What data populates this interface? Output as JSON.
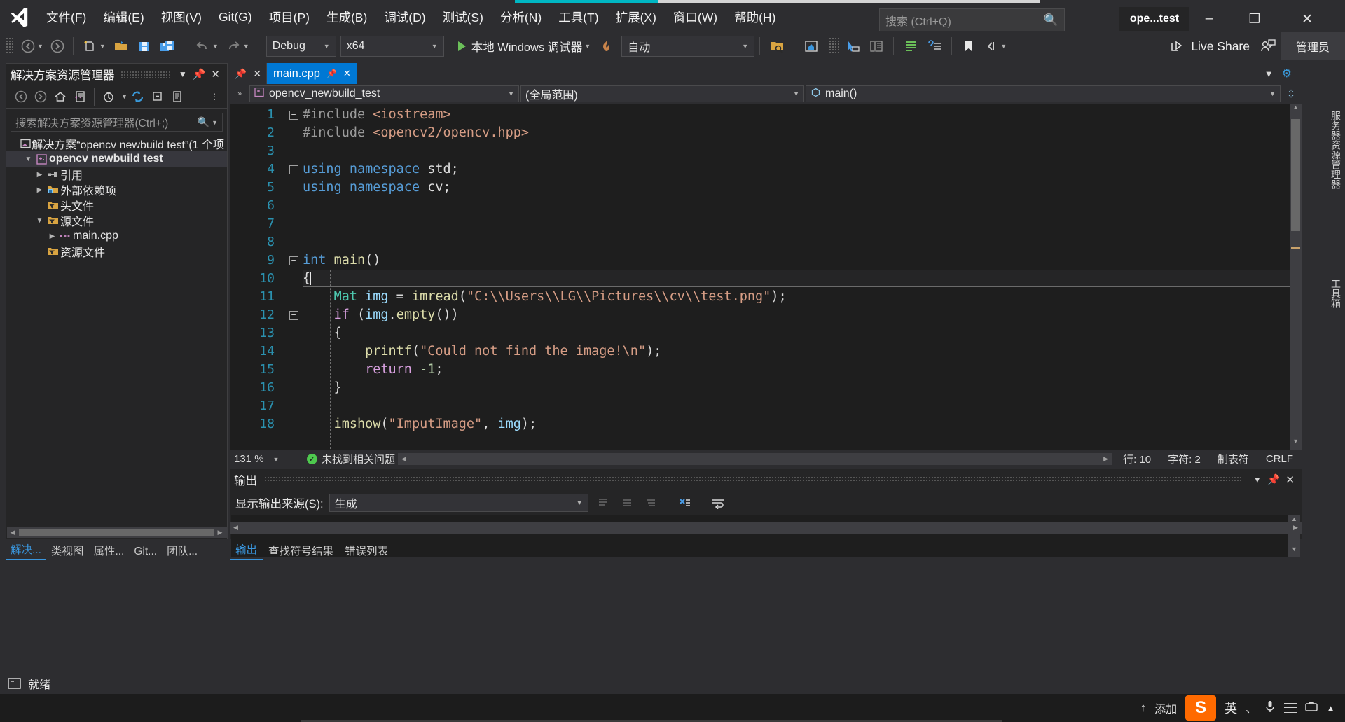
{
  "window": {
    "project_badge": "ope...test",
    "minimize": "–",
    "maximize": "❐",
    "close": "✕"
  },
  "menu": {
    "items": [
      {
        "label": "文件(F)",
        "name": "menu-file"
      },
      {
        "label": "编辑(E)",
        "name": "menu-edit"
      },
      {
        "label": "视图(V)",
        "name": "menu-view"
      },
      {
        "label": "Git(G)",
        "name": "menu-git"
      },
      {
        "label": "项目(P)",
        "name": "menu-project"
      },
      {
        "label": "生成(B)",
        "name": "menu-build"
      },
      {
        "label": "调试(D)",
        "name": "menu-debug"
      },
      {
        "label": "测试(S)",
        "name": "menu-test"
      },
      {
        "label": "分析(N)",
        "name": "menu-analyze"
      },
      {
        "label": "工具(T)",
        "name": "menu-tools"
      },
      {
        "label": "扩展(X)",
        "name": "menu-extensions"
      },
      {
        "label": "窗口(W)",
        "name": "menu-window"
      },
      {
        "label": "帮助(H)",
        "name": "menu-help"
      }
    ]
  },
  "search": {
    "placeholder": "搜索 (Ctrl+Q)",
    "icon": "search-icon"
  },
  "toolbar": {
    "configuration": "Debug",
    "platform": "x64",
    "start_debug": "本地 Windows 调试器",
    "auto_target": "自动",
    "live_share": "Live Share",
    "admin": "管理员"
  },
  "solution_explorer": {
    "title": "解决方案资源管理器",
    "search_placeholder": "搜索解决方案资源管理器(Ctrl+;)",
    "tree": [
      {
        "label": "解决方案“opencv newbuild test”(1 个项",
        "indent": 0,
        "arrow": "",
        "icon": "solution-icon",
        "bold": false
      },
      {
        "label": "opencv newbuild test",
        "indent": 1,
        "arrow": "▼",
        "icon": "cpp-project-icon",
        "bold": true
      },
      {
        "label": "引用",
        "indent": 2,
        "arrow": "▶",
        "icon": "references-icon",
        "bold": false
      },
      {
        "label": "外部依赖项",
        "indent": 2,
        "arrow": "▶",
        "icon": "ext-dependencies-icon",
        "bold": false
      },
      {
        "label": "头文件",
        "indent": 2,
        "arrow": "",
        "icon": "filter-folder-icon",
        "bold": false
      },
      {
        "label": "源文件",
        "indent": 2,
        "arrow": "▼",
        "icon": "filter-folder-icon",
        "bold": false
      },
      {
        "label": "main.cpp",
        "indent": 3,
        "arrow": "▶",
        "icon": "cpp-file-icon",
        "bold": false
      },
      {
        "label": "资源文件",
        "indent": 2,
        "arrow": "",
        "icon": "filter-folder-icon",
        "bold": false
      }
    ],
    "bottom_tabs": [
      {
        "label": "解决...",
        "active": true
      },
      {
        "label": "类视图",
        "active": false
      },
      {
        "label": "属性...",
        "active": false
      },
      {
        "label": "Git...",
        "active": false
      },
      {
        "label": "团队...",
        "active": false
      }
    ]
  },
  "right_docks": [
    "服务器资源管理器",
    "工具箱"
  ],
  "editor": {
    "tab": {
      "name": "main.cpp",
      "pin": "pin-icon",
      "close": "✕"
    },
    "nav": {
      "project": "opencv_newbuild_test",
      "scope": "(全局范围)",
      "member": "main()"
    },
    "status": {
      "zoom": "131 %",
      "issues": "未找到相关问题",
      "line": "行: 10",
      "column": "字符: 2",
      "insert_mode": "制表符",
      "line_endings": "CRLF"
    },
    "code_lines": [
      {
        "n": 1,
        "fold": "minus",
        "guide": "none",
        "tokens": [
          {
            "t": "#include ",
            "c": "pp"
          },
          {
            "t": "<iostream>",
            "c": "inc"
          }
        ]
      },
      {
        "n": 2,
        "fold": "",
        "guide": "solid",
        "tokens": [
          {
            "t": "#include ",
            "c": "pp"
          },
          {
            "t": "<opencv2/opencv.hpp>",
            "c": "inc"
          }
        ]
      },
      {
        "n": 3,
        "fold": "",
        "guide": "none",
        "tokens": []
      },
      {
        "n": 4,
        "fold": "minus",
        "guide": "none",
        "tokens": [
          {
            "t": "using",
            "c": "k"
          },
          {
            "t": " ",
            "c": "pl"
          },
          {
            "t": "namespace",
            "c": "k"
          },
          {
            "t": " std;",
            "c": "pl"
          }
        ]
      },
      {
        "n": 5,
        "fold": "",
        "guide": "solid",
        "tokens": [
          {
            "t": "using",
            "c": "k"
          },
          {
            "t": " ",
            "c": "pl"
          },
          {
            "t": "namespace",
            "c": "k"
          },
          {
            "t": " cv;",
            "c": "pl"
          }
        ]
      },
      {
        "n": 6,
        "fold": "",
        "guide": "none",
        "tokens": []
      },
      {
        "n": 7,
        "fold": "",
        "guide": "none",
        "tokens": []
      },
      {
        "n": 8,
        "fold": "",
        "guide": "none",
        "tokens": []
      },
      {
        "n": 9,
        "fold": "minus",
        "guide": "none",
        "tokens": [
          {
            "t": "int",
            "c": "k"
          },
          {
            "t": " ",
            "c": "pl"
          },
          {
            "t": "main",
            "c": "fn"
          },
          {
            "t": "()",
            "c": "pl"
          }
        ]
      },
      {
        "n": 10,
        "fold": "",
        "guide": "solid",
        "tokens": [
          {
            "t": "{",
            "c": "pl"
          }
        ]
      },
      {
        "n": 11,
        "fold": "",
        "guide": "solid",
        "tokens": [
          {
            "t": "    ",
            "c": "pl"
          },
          {
            "t": "Mat",
            "c": "ty"
          },
          {
            "t": " ",
            "c": "pl"
          },
          {
            "t": "img",
            "c": "id"
          },
          {
            "t": " = ",
            "c": "pl"
          },
          {
            "t": "imread",
            "c": "fn"
          },
          {
            "t": "(",
            "c": "pl"
          },
          {
            "t": "\"C:\\\\Users\\\\LG\\\\Pictures\\\\cv\\\\test.png\"",
            "c": "str"
          },
          {
            "t": ");",
            "c": "pl"
          }
        ]
      },
      {
        "n": 12,
        "fold": "minus",
        "guide": "solid",
        "tokens": [
          {
            "t": "    ",
            "c": "pl"
          },
          {
            "t": "if",
            "c": "kf"
          },
          {
            "t": " (",
            "c": "pl"
          },
          {
            "t": "img",
            "c": "id"
          },
          {
            "t": ".",
            "c": "pl"
          },
          {
            "t": "empty",
            "c": "fn"
          },
          {
            "t": "())",
            "c": "pl"
          }
        ]
      },
      {
        "n": 13,
        "fold": "",
        "guide": "solid",
        "tokens": [
          {
            "t": "    {",
            "c": "pl"
          }
        ]
      },
      {
        "n": 14,
        "fold": "",
        "guide": "solid",
        "tokens": [
          {
            "t": "        ",
            "c": "pl"
          },
          {
            "t": "printf",
            "c": "fn"
          },
          {
            "t": "(",
            "c": "pl"
          },
          {
            "t": "\"Could not find the image!\\n\"",
            "c": "str"
          },
          {
            "t": ");",
            "c": "pl"
          }
        ]
      },
      {
        "n": 15,
        "fold": "",
        "guide": "solid",
        "tokens": [
          {
            "t": "        ",
            "c": "pl"
          },
          {
            "t": "return",
            "c": "kf"
          },
          {
            "t": " ",
            "c": "pl"
          },
          {
            "t": "-1",
            "c": "num"
          },
          {
            "t": ";",
            "c": "pl"
          }
        ]
      },
      {
        "n": 16,
        "fold": "end",
        "guide": "solid",
        "tokens": [
          {
            "t": "    }",
            "c": "pl"
          }
        ]
      },
      {
        "n": 17,
        "fold": "",
        "guide": "solid",
        "tokens": []
      },
      {
        "n": 18,
        "fold": "",
        "guide": "solid",
        "tokens": [
          {
            "t": "    ",
            "c": "pl"
          },
          {
            "t": "imshow",
            "c": "fn"
          },
          {
            "t": "(",
            "c": "pl"
          },
          {
            "t": "\"ImputImage\"",
            "c": "str"
          },
          {
            "t": ", ",
            "c": "pl"
          },
          {
            "t": "img",
            "c": "id"
          },
          {
            "t": ");",
            "c": "pl"
          }
        ]
      }
    ]
  },
  "output": {
    "title": "输出",
    "source_label": "显示输出来源(S):",
    "source_value": "生成",
    "tabs": [
      {
        "label": "输出",
        "active": true
      },
      {
        "label": "查找符号结果",
        "active": false
      },
      {
        "label": "错误列表",
        "active": false
      }
    ]
  },
  "status_bar": {
    "ready": "就绪"
  },
  "taskbar": {
    "add_label": "添加",
    "ime_lang": "英",
    "ime_brand": "S"
  },
  "colors": {
    "accent_blue": "#0078d4",
    "progress_teal": "#00b7c3",
    "link_blue": "#3a96dd",
    "panel_bg": "#252526",
    "chrome_bg": "#2d2d30",
    "editor_bg": "#1e1e1e"
  }
}
